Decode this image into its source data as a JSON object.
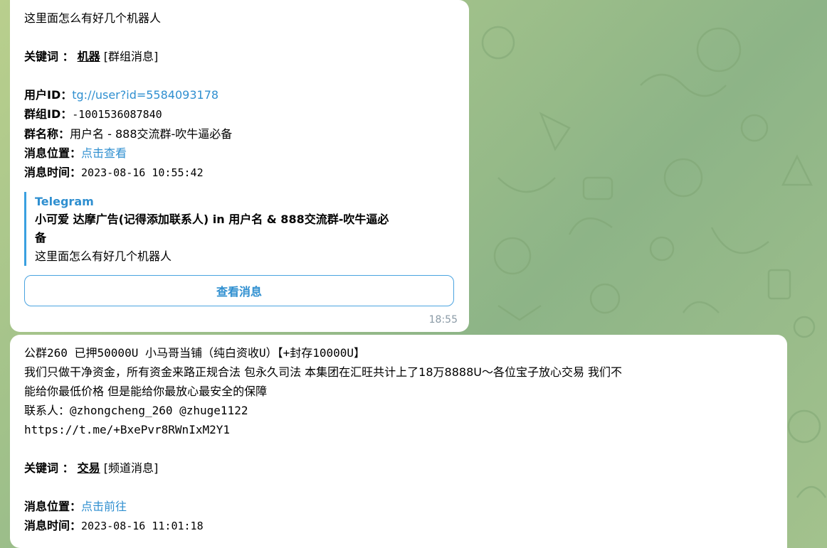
{
  "message1": {
    "text": "这里面怎么有好几个机器人",
    "keyword_label": "关键词 ：",
    "keyword": "机器",
    "keyword_type": "[群组消息]",
    "user_id_label": "用户ID：",
    "user_id_link": "tg://user?id=5584093178",
    "group_id_label": "群组ID：",
    "group_id": "-1001536087840",
    "group_name_label": "群名称：",
    "group_name": "用户名 - 888交流群-吹牛逼必备",
    "location_label": "消息位置：",
    "location_link": "点击查看",
    "time_label": "消息时间：",
    "time_value": "2023-08-16 10:55:42",
    "quote": {
      "title": "Telegram",
      "line1": "小可爱 达摩广告(记得添加联系人) in 用户名 & 888交流群-吹牛逼必",
      "line2": "备",
      "line3": "这里面怎么有好几个机器人"
    },
    "button_label": "查看消息",
    "timestamp": "18:55"
  },
  "message2": {
    "line1": "公群260 已押50000U 小马哥当铺（纯白资收U）【+封存10000U】",
    "line2": "我们只做干净资金，所有资金来路正规合法 包永久司法 本集团在汇旺共计上了18万8888U～各位宝子放心交易 我们不",
    "line3": "能给你最低价格 但是能给你最放心最安全的保障",
    "line4": "联系人：@zhongcheng_260 @zhuge1122",
    "line5": "https://t.me/+BxePvr8RWnIxM2Y1",
    "keyword_label": "关键词 ：",
    "keyword": "交易",
    "keyword_type": "[频道消息]",
    "location_label": "消息位置：",
    "location_link": "点击前往",
    "time_label": "消息时间：",
    "time_value": "2023-08-16 11:01:18"
  },
  "colors": {
    "link": "#2f8fd0",
    "accent": "#3aa0e0",
    "wallpaper": "#9fc08a"
  }
}
